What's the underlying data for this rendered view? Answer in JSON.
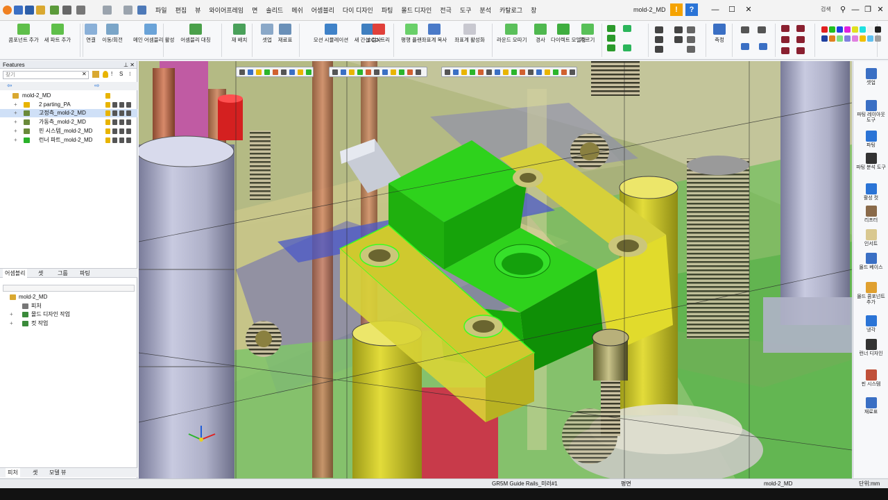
{
  "titlebar": {
    "menus": [
      "파일",
      "편집",
      "뷰",
      "와이어프레임",
      "면",
      "솔리드",
      "메쉬",
      "어셈블리",
      "다이 디자인",
      "파팅",
      "몰드 디자인",
      "전극",
      "도구",
      "분석",
      "카탈로그",
      "창"
    ],
    "document_title": "mold-2_MD",
    "search_label": "검색"
  },
  "ribbon": {
    "buttons": [
      "콤포넌트 추가",
      "새 파트 추가",
      "연결",
      "이동/회전",
      "메인 어셈블리 활성",
      "어셈블리 대칭",
      "재 배치",
      "셋업",
      "재료표",
      "모션 시뮬레이션",
      "새 간섭 검사",
      "ECO 트리",
      "평행 플랜",
      "좌표계 복사",
      "좌표계 활성화",
      "라운드 모따기",
      "경사",
      "다이렉트 모델링",
      "자르기",
      "측정"
    ]
  },
  "features": {
    "title": "Features",
    "find_placeholder": "찾기",
    "tree": [
      {
        "label": "mold-2_MD"
      },
      {
        "label": "2 parting_PA"
      },
      {
        "label": "고정측_mold-2_MD"
      },
      {
        "label": "가동측_mold-2_MD"
      },
      {
        "label": "핀 시스템_mold-2_MD"
      },
      {
        "label": "런너 파트_mold-2_MD"
      }
    ],
    "tabs": [
      "어셈블리",
      "셋",
      "그룹",
      "파팅"
    ],
    "assembly_tree": [
      {
        "label": "mold-2_MD"
      },
      {
        "label": "피처"
      },
      {
        "label": "몰드 디자인 작업"
      },
      {
        "label": "컷 작업"
      }
    ],
    "bottom_tabs": [
      "피처",
      "셋",
      "모델 뷰"
    ]
  },
  "right_panel": {
    "buttons": [
      "셋업",
      "파팅 레이아웃 도구",
      "파팅",
      "파팅 분석 도구",
      "활성 컷",
      "리프터",
      "인서트",
      "몰드 베이스",
      "몰드 콤포넌트 추가",
      "냉각",
      "런너 디자인",
      "핀 시스템",
      "재료표"
    ]
  },
  "status": {
    "file": "GR5M Guide Rails_미러#1",
    "plane": "평면",
    "model": "mold-2_MD",
    "units": "단위:mm"
  },
  "colors": {
    "accent_green": "#22c400",
    "accent_yellow": "#d8d020",
    "title_bg": "#f3f3f3",
    "ribbon_bg": "#f7f8fa",
    "warning": "#f5a300",
    "help": "#2b74d6"
  }
}
